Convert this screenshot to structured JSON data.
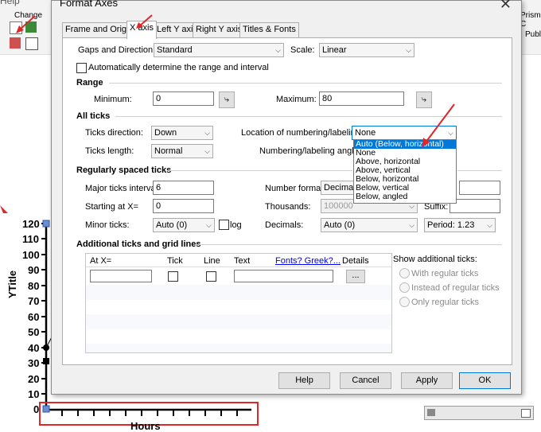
{
  "background": {
    "menu_help": "Help",
    "change_label": "Change",
    "prism_label": "Prism C",
    "publi_label": "Publi",
    "y_title": "YTitle",
    "x_title": "Hours",
    "y_ticks": [
      "120",
      "110",
      "100",
      "90",
      "80",
      "70",
      "60",
      "50",
      "40",
      "30",
      "20",
      "10",
      "0"
    ]
  },
  "dialog": {
    "title": "Format Axes",
    "close_glyph": "✕",
    "tabs": [
      "Frame and Origin",
      "X axis",
      "Left Y axis",
      "Right Y axis",
      "Titles & Fonts"
    ],
    "gaps": {
      "label": "Gaps and Direction:",
      "value": "Standard"
    },
    "scale": {
      "label": "Scale:",
      "value": "Linear"
    },
    "auto_range_label": "Automatically determine the range and interval",
    "range": {
      "header": "Range",
      "min_label": "Minimum:",
      "min_value": "0",
      "max_label": "Maximum:",
      "max_value": "80"
    },
    "all_ticks": {
      "header": "All ticks",
      "dir_label": "Ticks direction:",
      "dir_value": "Down",
      "len_label": "Ticks length:",
      "len_value": "Normal",
      "loc_label": "Location of numbering/labeling:",
      "loc_value": "None",
      "angle_label": "Numbering/labeling angle:",
      "options": [
        "Auto (Below, horizontal)",
        "None",
        "Above, horizontal",
        "Above, vertical",
        "Below, horizontal",
        "Below, vertical",
        "Below, angled"
      ]
    },
    "regular": {
      "header": "Regularly spaced ticks",
      "major_label": "Major ticks interval:",
      "major_value": "6",
      "start_label": "Starting at X=",
      "start_value": "0",
      "minor_label": "Minor ticks:",
      "minor_value": "Auto (0)",
      "log_label": "log",
      "numfmt_label": "Number format:",
      "numfmt_value": "Decimal",
      "thousands_label": "Thousands:",
      "thousands_value": "100000",
      "decimals_label": "Decimals:",
      "decimals_value": "Auto (0)",
      "suffix_label": "Suffix:",
      "period_value": "Period: 1.23"
    },
    "additional": {
      "header": "Additional ticks and grid lines",
      "cols": [
        "At X=",
        "Tick",
        "Line",
        "Text",
        "Fonts? Greek?...",
        "Details"
      ],
      "details_btn": "...",
      "show_label": "Show additional ticks:",
      "radios": [
        "With regular ticks",
        "Instead of regular ticks",
        "Only regular ticks"
      ]
    },
    "buttons": {
      "help": "Help",
      "cancel": "Cancel",
      "apply": "Apply",
      "ok": "OK"
    }
  },
  "colors": {
    "accent": "#0078d7",
    "annotation_red": "#e0282a",
    "link": "#0000ee"
  }
}
